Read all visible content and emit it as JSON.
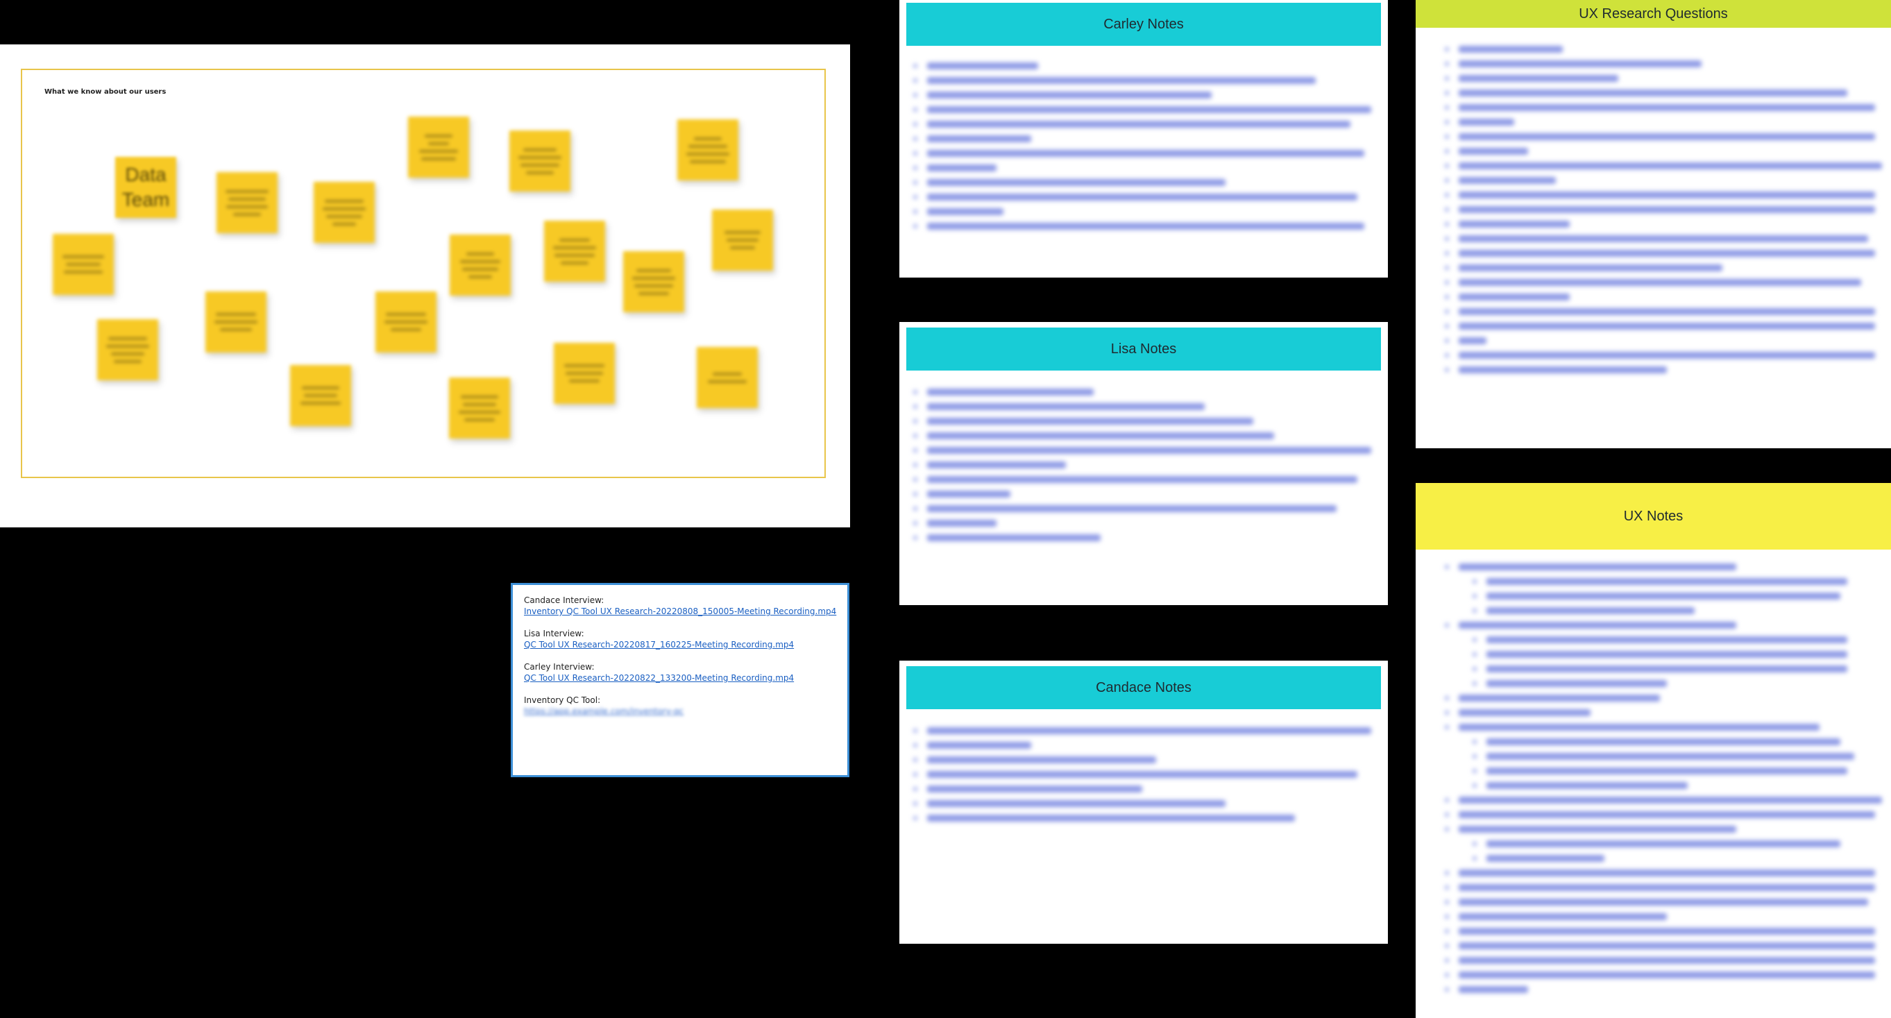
{
  "board": {
    "title": "What we know about our users",
    "featured_sticky": "Data\nTeam",
    "sticky_count": 20
  },
  "links": {
    "items": [
      {
        "label": "Candace Interview:",
        "url": "Inventory QC Tool UX Research-20220808_150005-Meeting Recording.mp4"
      },
      {
        "label": "Lisa Interview:",
        "url": "QC Tool UX Research-20220817_160225-Meeting Recording.mp4"
      },
      {
        "label": "Carley Interview:",
        "url": "QC Tool UX Research-20220822_133200-Meeting Recording.mp4"
      },
      {
        "label": "Inventory QC Tool:",
        "url": "https://app.example.com/inventory-qc"
      }
    ]
  },
  "panels": {
    "carley": {
      "title": "Carley Notes"
    },
    "lisa": {
      "title": "Lisa Notes"
    },
    "candace": {
      "title": "Candace Notes"
    },
    "ux_questions": {
      "title": "UX Research Questions"
    },
    "ux_notes": {
      "title": "UX Notes"
    }
  },
  "colors": {
    "teal_header": "#18ccd6",
    "lime_header": "#cfe23a",
    "yellow_header": "#f7ef46",
    "sticky": "#f7c925",
    "board_border": "#e8c54a",
    "link": "#1a5fc2"
  }
}
